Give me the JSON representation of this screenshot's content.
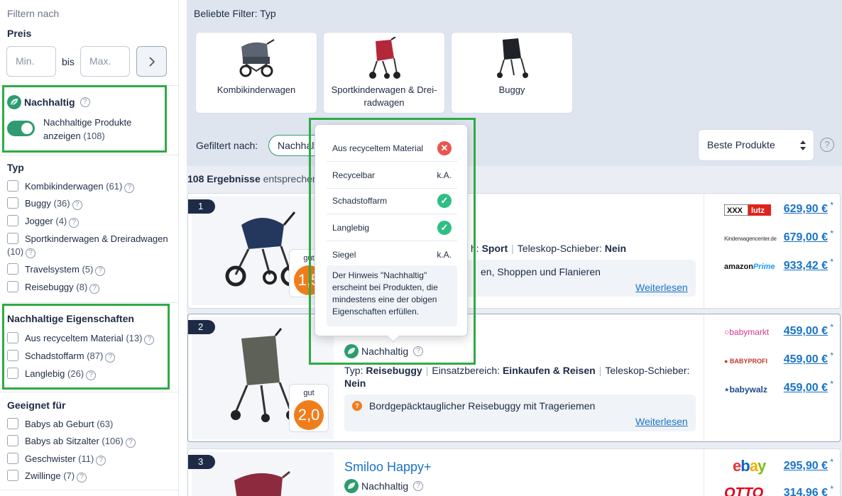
{
  "sidebar": {
    "title": "Filtern nach",
    "price": {
      "heading": "Preis",
      "min_placeholder": "Min.",
      "bis": "bis",
      "max_placeholder": "Max."
    },
    "sustainable": {
      "label": "Nachhaltig",
      "toggle_label": "Nachhaltige Produkte anzeigen",
      "toggle_count": "(108)",
      "toggle_on": true
    },
    "type": {
      "heading": "Typ",
      "items": [
        {
          "label": "Kombikinderwagen",
          "count": "(61)"
        },
        {
          "label": "Buggy",
          "count": "(36)"
        },
        {
          "label": "Jogger",
          "count": "(4)"
        },
        {
          "label": "Sportkinderwagen & Dreiradwagen",
          "count": "(10)"
        },
        {
          "label": "Travelsystem",
          "count": "(5)"
        },
        {
          "label": "Reisebuggy",
          "count": "(8)"
        }
      ]
    },
    "sust_props": {
      "heading": "Nachhaltige Eigenschaften",
      "items": [
        {
          "label": "Aus recyceltem Material",
          "count": "(13)"
        },
        {
          "label": "Schadstoffarm",
          "count": "(87)"
        },
        {
          "label": "Langlebig",
          "count": "(26)"
        }
      ]
    },
    "suitable": {
      "heading": "Geeignet für",
      "items": [
        {
          "label": "Babys ab Geburt",
          "count": "(63)"
        },
        {
          "label": "Babys ab Sitzalter",
          "count": "(106)"
        },
        {
          "label": "Geschwister",
          "count": "(11)"
        },
        {
          "label": "Zwillinge",
          "count": "(7)"
        }
      ]
    }
  },
  "main": {
    "popular_title": "Beliebte Filter: Typ",
    "type_cards": [
      {
        "label": "Kombikinderwagen"
      },
      {
        "label": "Sportkinderwagen & Drei-radwagen"
      },
      {
        "label": "Buggy"
      }
    ],
    "filtered_by": "Gefiltert nach:",
    "chip_label": "Nachhaltig",
    "sort_value": "Beste Produkte",
    "results_count": "108 Ergebnisse",
    "results_suffix": "entsprechen"
  },
  "products": [
    {
      "rank": "1",
      "grade_label": "gut",
      "grade_value": "1,5",
      "spec_frag1": "h:",
      "spec_frag1_val": "Sport",
      "spec_key2": "Teleskop-Schieber:",
      "spec_val2": "Nein",
      "hint": "en, Shoppen und Flanieren",
      "more": "Weiterlesen",
      "shops": [
        {
          "name": "XXXLutz",
          "price": "629,90 €"
        },
        {
          "name": "Kinderwagencenter.de",
          "price": "679,00 €"
        },
        {
          "name": "amazonPrime",
          "price": "933,42 €"
        }
      ]
    },
    {
      "rank": "2",
      "grade_label": "gut",
      "grade_value": "2,0",
      "sust_label": "Nachhaltig",
      "spec_key1": "Typ:",
      "spec_val1": "Reisebuggy",
      "spec_key2": "Einsatzbereich:",
      "spec_val2": "Einkaufen & Reisen",
      "spec_key3": "Teleskop-Schieber:",
      "spec_val3": "Nein",
      "hint": "Bordgepäcktauglicher Reisebuggy mit Trageriemen",
      "more": "Weiterlesen",
      "shops": [
        {
          "name": "babymarkt",
          "price": "459,00 €"
        },
        {
          "name": "BABYPROFI",
          "price": "459,00 €"
        },
        {
          "name": "babywalz",
          "price": "459,00 €"
        }
      ]
    },
    {
      "rank": "3",
      "name": "Smiloo Happy+",
      "sust_label": "Nachhaltig",
      "shops": [
        {
          "name": "ebay",
          "price": "295,90 €"
        },
        {
          "name": "OTTO",
          "price": "314,96 €"
        }
      ]
    }
  ],
  "popover": {
    "rows": [
      {
        "label": "Aus recyceltem Material",
        "status": "no"
      },
      {
        "label": "Recycelbar",
        "value": "k.A."
      },
      {
        "label": "Schadstoffarm",
        "status": "yes"
      },
      {
        "label": "Langlebig",
        "status": "yes"
      },
      {
        "label": "Siegel",
        "value": "k.A."
      }
    ],
    "note": "Der Hinweis \"Nachhaltig\" erscheint bei Produkten, die mindestens eine der obigen Eigenschaften erfüllen."
  },
  "colors": {
    "accent": "#2e9b70",
    "link": "#1a73c8",
    "highlight": "#2eab45",
    "grade": "#f07d1c",
    "no": "#e8554e",
    "yes": "#2fbe84"
  }
}
